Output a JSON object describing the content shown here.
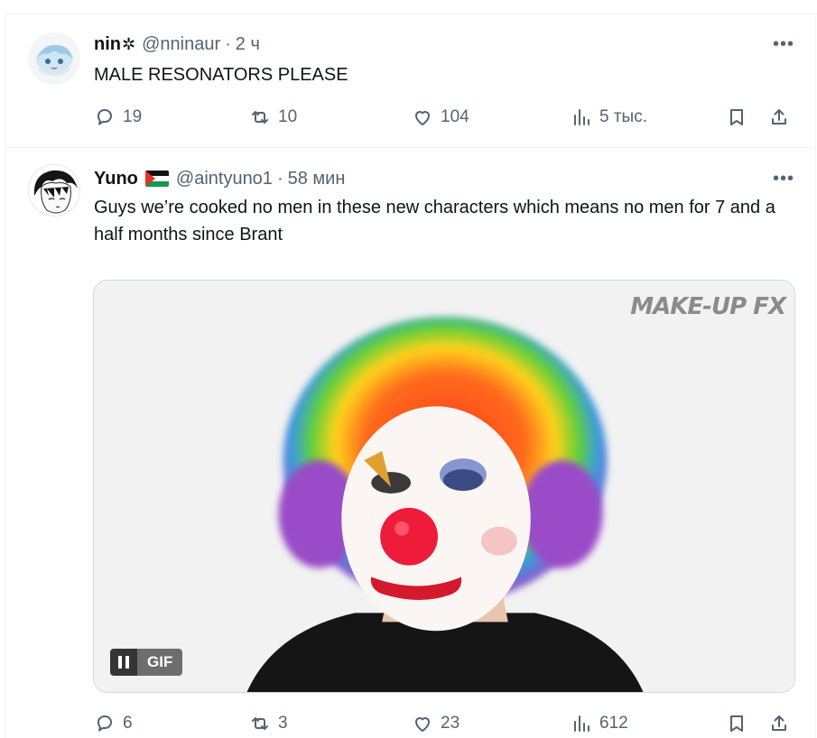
{
  "tweets": [
    {
      "name": "nin",
      "name_decoration": "✲",
      "handle": "@nninaur",
      "time": "2 ч",
      "text": "MALE RESONATORS PLEASE",
      "replies": "19",
      "retweets": "10",
      "likes": "104",
      "views": "5 тыс.",
      "avatar": "anime-character-avatar"
    },
    {
      "name": "Yuno",
      "handle": "@aintyuno1",
      "time": "58 мин",
      "text": "Guys we’re cooked no men in these new characters which means no men for 7 and a half months since Brant",
      "media": {
        "type": "gif",
        "watermark": "MAKE-UP FX",
        "badge": "GIF",
        "description_icon": "clown-gif"
      },
      "replies": "6",
      "retweets": "3",
      "likes": "23",
      "views": "612",
      "flag": "palestine-flag",
      "avatar": "manga-character-avatar"
    }
  ],
  "icons": {
    "more": "more-icon",
    "reply": "reply-icon",
    "retweet": "retweet-icon",
    "like": "heart-icon",
    "views": "views-icon",
    "bookmark": "bookmark-icon",
    "share": "share-icon"
  },
  "colors": {
    "text": "#0f1419",
    "secondary": "#536471",
    "border": "#eff3f4"
  }
}
